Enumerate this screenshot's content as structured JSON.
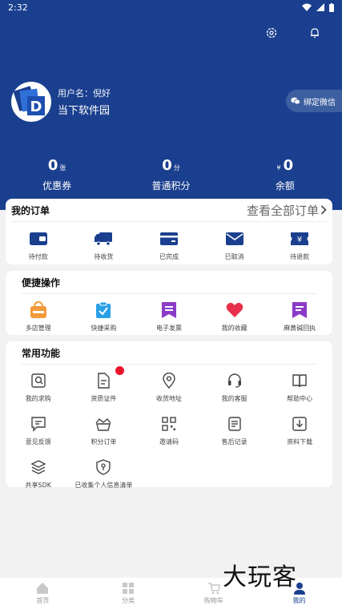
{
  "status_bar": {
    "time": "2:32"
  },
  "profile": {
    "username_label": "用户名：倪好",
    "company": "当下软件园",
    "avatar_letter": "D"
  },
  "bind_wechat": "绑定微信",
  "stats": [
    {
      "value": "0",
      "unit": "张",
      "prefix": "",
      "label": "优惠券"
    },
    {
      "value": "0",
      "unit": "分",
      "prefix": "",
      "label": "普通积分"
    },
    {
      "value": "0",
      "unit": "",
      "prefix": "¥",
      "label": "余额"
    }
  ],
  "orders": {
    "title": "我的订单",
    "see_all": "查看全部订单",
    "items": [
      {
        "label": "待付款",
        "icon": "wallet-icon"
      },
      {
        "label": "待收货",
        "icon": "truck-icon"
      },
      {
        "label": "已完成",
        "icon": "card-icon"
      },
      {
        "label": "已取消",
        "icon": "envelope-icon"
      },
      {
        "label": "待退款",
        "icon": "refund-ticket-icon"
      }
    ]
  },
  "quick": {
    "title": "便捷操作",
    "items": [
      {
        "label": "多店管理",
        "icon": "store-basket-icon",
        "color": "#f39a3a"
      },
      {
        "label": "快捷采购",
        "icon": "clipboard-check-icon",
        "color": "#2aa0e6"
      },
      {
        "label": "电子发票",
        "icon": "invoice-bookmark-icon",
        "color": "#8a3cc8"
      },
      {
        "label": "我的收藏",
        "icon": "heart-icon",
        "color": "#e8304a"
      },
      {
        "label": "麻黄碱回执",
        "icon": "receipt-bookmark-icon",
        "color": "#8a3cc8"
      }
    ]
  },
  "common": {
    "title": "常用功能",
    "items": [
      {
        "label": "我的求购",
        "icon": "search-doc-icon"
      },
      {
        "label": "资质证件",
        "icon": "document-icon"
      },
      {
        "label": "收货地址",
        "icon": "location-pin-icon"
      },
      {
        "label": "我的客服",
        "icon": "headset-icon"
      },
      {
        "label": "帮助中心",
        "icon": "open-book-icon"
      },
      {
        "label": "意见反馈",
        "icon": "chat-icon"
      },
      {
        "label": "积分订单",
        "icon": "crown-basket-icon"
      },
      {
        "label": "邀请码",
        "icon": "qr-code-icon"
      },
      {
        "label": "售后记录",
        "icon": "list-doc-icon"
      },
      {
        "label": "资料下载",
        "icon": "download-icon"
      },
      {
        "label": "共享SDK",
        "icon": "layers-icon"
      },
      {
        "label": "已收集个人信息清单",
        "icon": "shield-icon"
      }
    ]
  },
  "tabs": [
    {
      "label": "首页",
      "icon": "home-icon"
    },
    {
      "label": "分类",
      "icon": "category-icon"
    },
    {
      "label": "购物车",
      "icon": "cart-icon"
    },
    {
      "label": "我的",
      "icon": "user-icon"
    }
  ],
  "watermark": "大玩客",
  "colors": {
    "primary": "#1a3f8e",
    "badge_red": "#e8142b"
  }
}
